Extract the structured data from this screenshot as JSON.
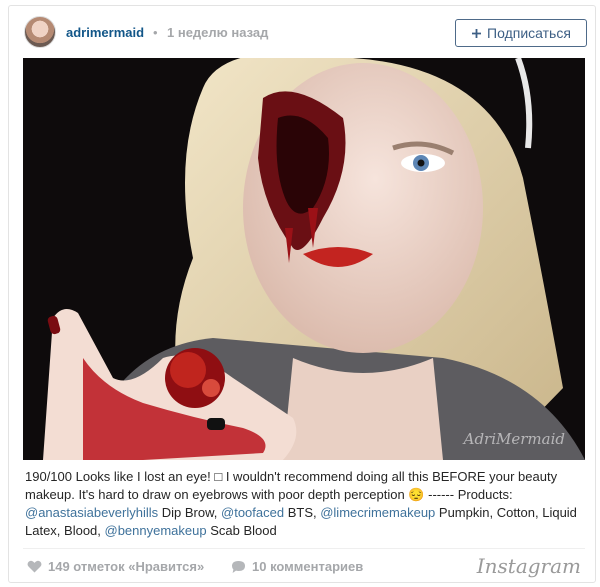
{
  "post": {
    "username": "adrimermaid",
    "dot": "•",
    "time": "1 неделю назад",
    "follow_label": "Подписаться",
    "watermark": "AdriMermaid",
    "caption": {
      "part1": "190/100 Looks like I lost an eye! ",
      "emoji_placeholder": "□",
      "part2": " I wouldn't recommend doing all this BEFORE your beauty makeup. It's hard to draw on eyebrows with poor depth perception ",
      "smile": "😔",
      "part3": " ------ Products: ",
      "m1": "@anastasiabeverlyhills",
      "t1": " Dip Brow, ",
      "m2": "@toofaced",
      "t2": " BTS, ",
      "m3": "@limecrimemakeup",
      "t3": " Pumpkin, Cotton, Liquid Latex, Blood, ",
      "m4": "@bennyemakeup",
      "t4": " Scab Blood"
    },
    "likes_text": "149 отметок «Нравится»",
    "comments_text": "10 комментариев",
    "brand": "Instagram"
  },
  "icons": [
    "heart-icon",
    "comment-icon",
    "plus-icon"
  ],
  "colors": {
    "link": "#125688",
    "mention": "#3f729b",
    "muted": "#a5a7aa",
    "button_text": "#3d5f85"
  }
}
